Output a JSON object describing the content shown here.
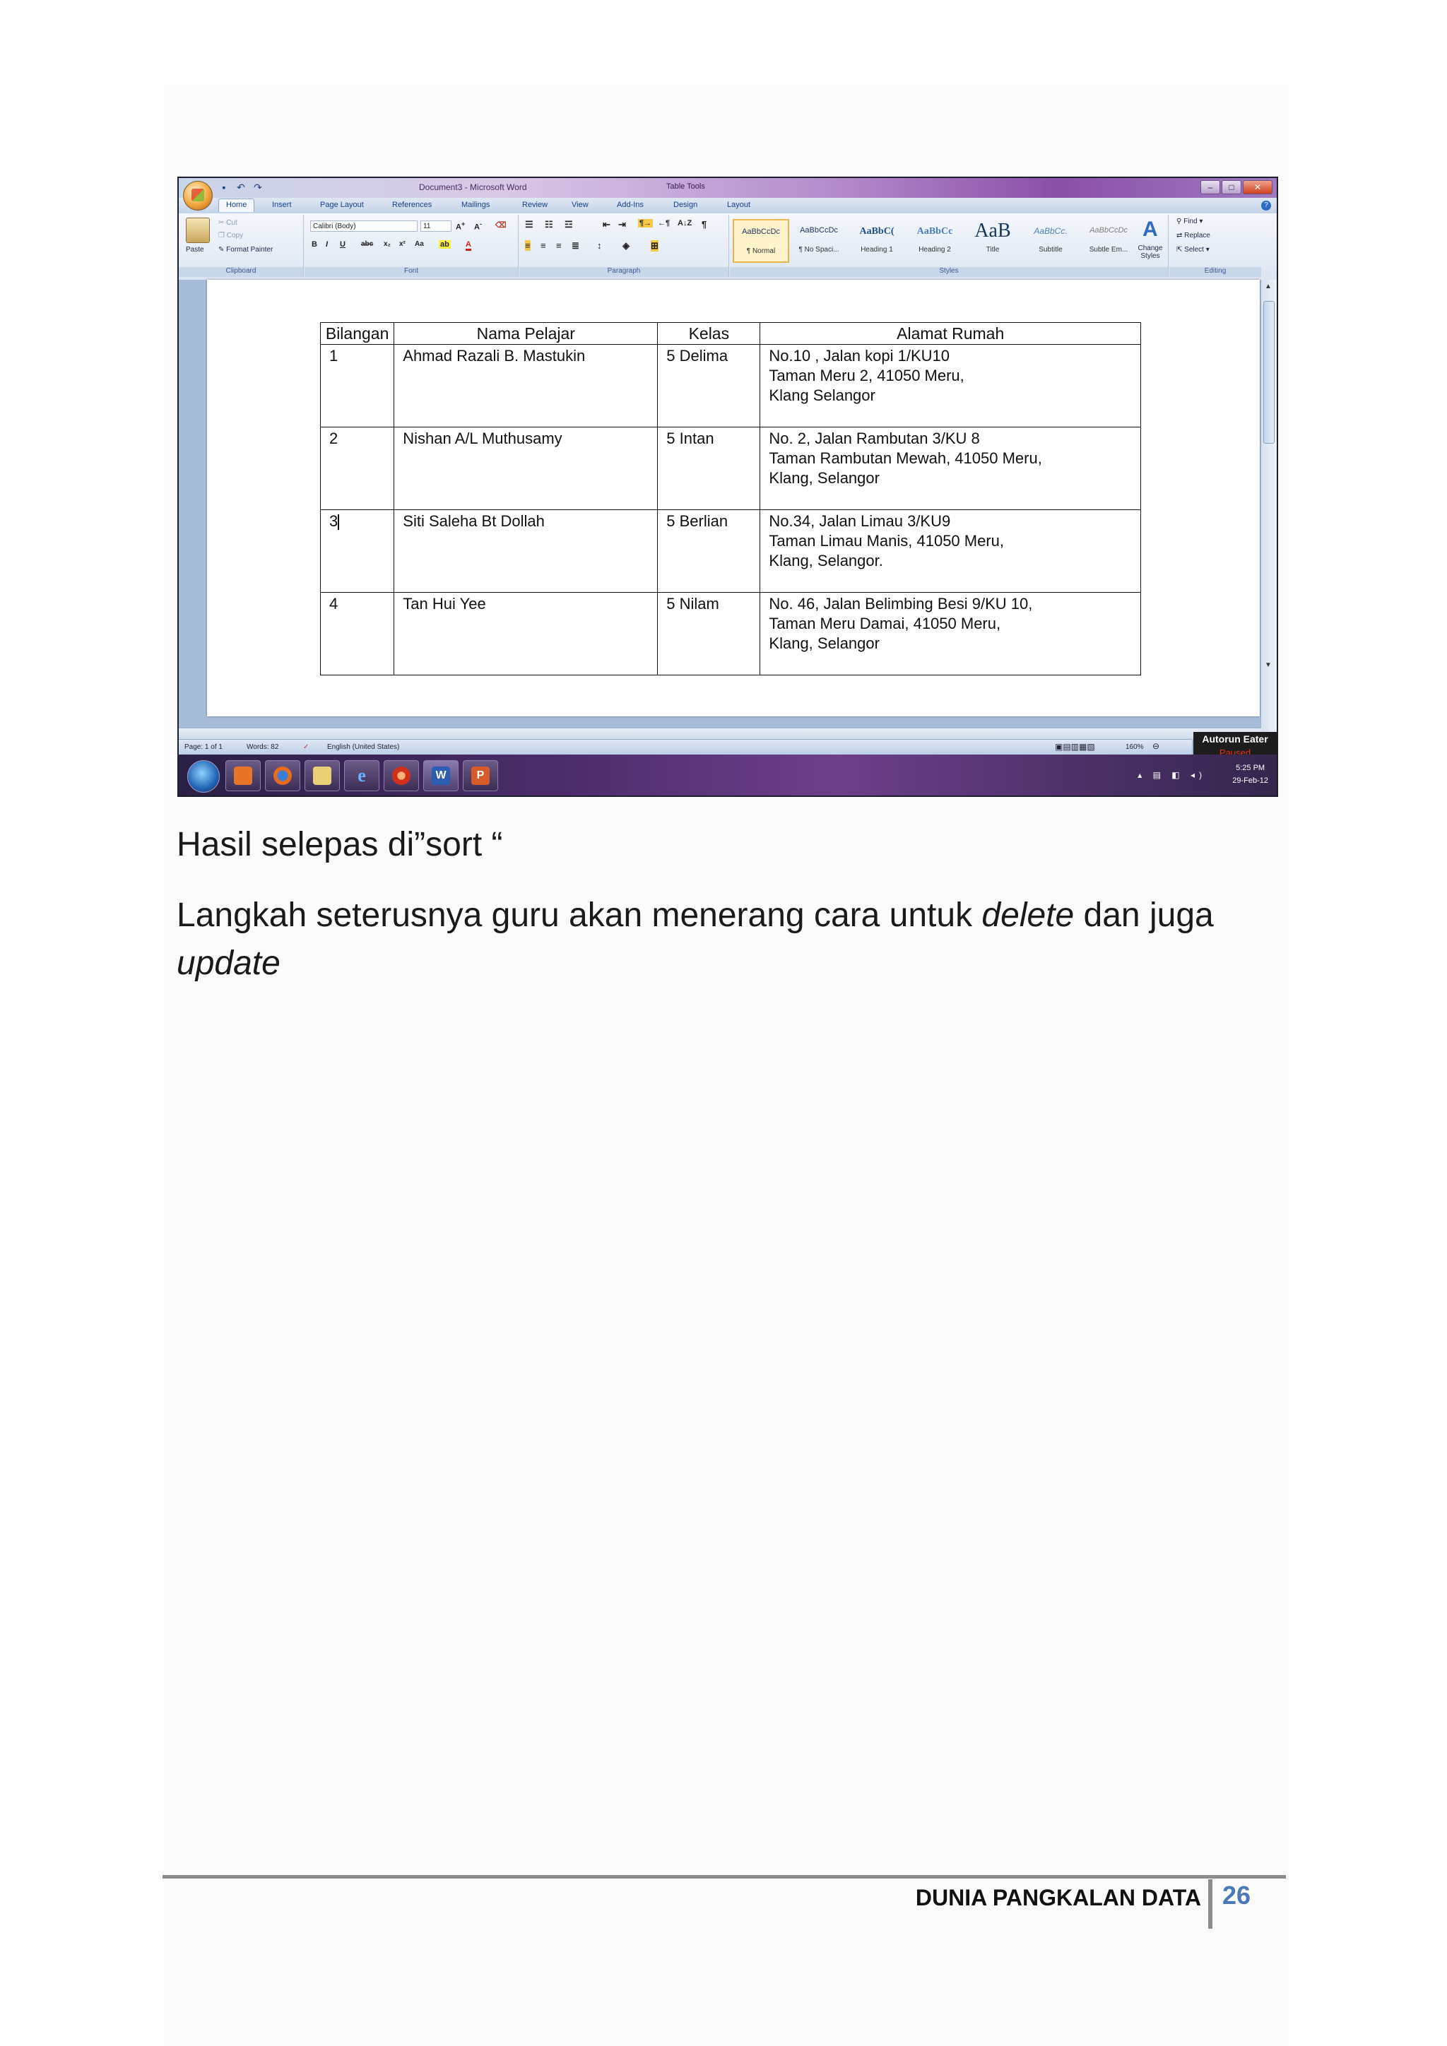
{
  "word_window": {
    "title": "Document3 - Microsoft Word",
    "contextual_tab": "Table Tools",
    "tabs": [
      "Home",
      "Insert",
      "Page Layout",
      "References",
      "Mailings",
      "Review",
      "View",
      "Add-Ins",
      "Design",
      "Layout"
    ],
    "active_tab": "Home",
    "clipboard": {
      "paste": "Paste",
      "cut": "Cut",
      "copy": "Copy",
      "format_painter": "Format Painter",
      "label": "Clipboard"
    },
    "font": {
      "name": "Calibri (Body)",
      "size": "11",
      "label": "Font"
    },
    "paragraph_label": "Paragraph",
    "styles": [
      {
        "sample": "AaBbCcDc",
        "name": "¶ Normal"
      },
      {
        "sample": "AaBbCcDc",
        "name": "¶ No Spaci..."
      },
      {
        "sample": "AaBbC(",
        "name": "Heading 1"
      },
      {
        "sample": "AaBbCc",
        "name": "Heading 2"
      },
      {
        "sample": "AaB",
        "name": "Title"
      },
      {
        "sample": "AaBbCc.",
        "name": "Subtitle"
      },
      {
        "sample": "AaBbCcDc",
        "name": "Subtle Em..."
      }
    ],
    "styles_label": "Styles",
    "change_styles": "Change Styles",
    "editing": {
      "find": "Find",
      "replace": "Replace",
      "select": "Select",
      "label": "Editing"
    },
    "table": {
      "headers": [
        "Bilangan",
        "Nama Pelajar",
        "Kelas",
        "Alamat Rumah"
      ],
      "rows": [
        {
          "no": "1",
          "nama": "Ahmad Razali B. Mastukin",
          "kelas": "5 Delima",
          "alamat": [
            "No.10 , Jalan kopi 1/KU10",
            "Taman Meru 2, 41050 Meru,",
            "Klang Selangor"
          ]
        },
        {
          "no": "2",
          "nama": "Nishan A/L Muthusamy",
          "kelas": "5 Intan",
          "alamat": [
            "No. 2, Jalan Rambutan 3/KU 8",
            "Taman Rambutan Mewah, 41050 Meru,",
            "Klang, Selangor"
          ]
        },
        {
          "no": "3",
          "nama": "Siti Saleha Bt Dollah",
          "kelas": "5 Berlian",
          "alamat": [
            "No.34, Jalan Limau 3/KU9",
            "Taman Limau Manis, 41050 Meru,",
            "Klang, Selangor."
          ]
        },
        {
          "no": "4",
          "nama": "Tan Hui Yee",
          "kelas": "5 Nilam",
          "alamat": [
            "No. 46, Jalan Belimbing Besi 9/KU 10,",
            "Taman Meru Damai, 41050 Meru,",
            "Klang, Selangor"
          ]
        }
      ]
    },
    "status": {
      "page": "Page: 1 of 1",
      "words": "Words: 82",
      "language": "English (United States)",
      "zoom": "160%"
    },
    "autorun": {
      "title": "Autorun Eater",
      "state": "Paused"
    },
    "clock": {
      "time": "5:25 PM",
      "date": "29-Feb-12"
    }
  },
  "caption": "Hasil selepas di”sort “",
  "paragraph": {
    "part1": "Langkah seterusnya guru akan menerang cara untuk ",
    "em1": "delete",
    "part2": " dan juga ",
    "em2": "update"
  },
  "footer": {
    "title": "DUNIA PANGKALAN DATA",
    "page_number": "26"
  }
}
